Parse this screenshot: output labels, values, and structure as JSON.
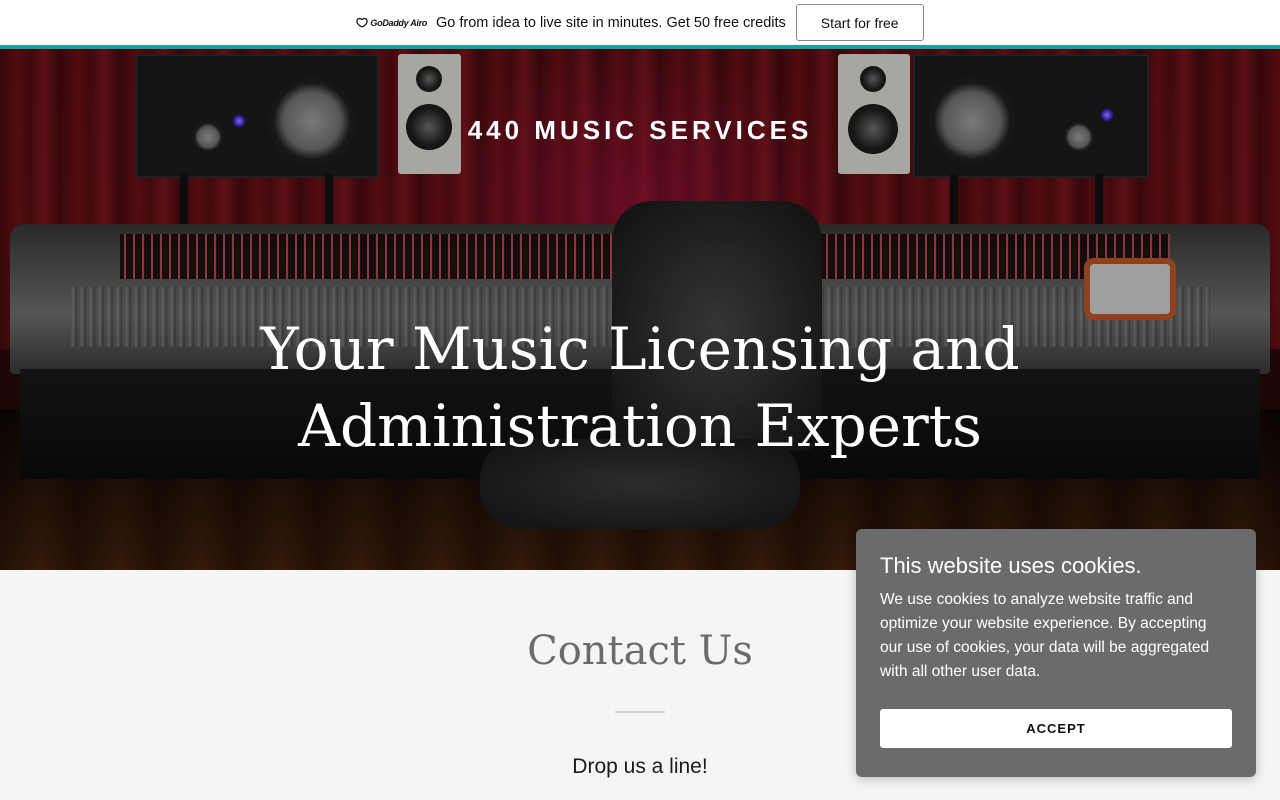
{
  "promo": {
    "logo_text": "GoDaddy Airo",
    "message": "Go from idea to live site in minutes. Get 50 free credits",
    "cta_label": "Start for free",
    "accent_color": "#1b9ea0"
  },
  "header": {
    "brand": "440 MUSIC SERVICES"
  },
  "hero": {
    "title": "Your Music Licensing and Administration Experts"
  },
  "contact": {
    "title": "Contact Us",
    "subtitle": "Drop us a line!"
  },
  "cookie_banner": {
    "title": "This website uses cookies.",
    "body": "We use cookies to analyze website traffic and optimize your website experience. By accepting our use of cookies, your data will be aggregated with all other user data.",
    "accept_label": "ACCEPT",
    "background_color": "#6b6b6b"
  }
}
